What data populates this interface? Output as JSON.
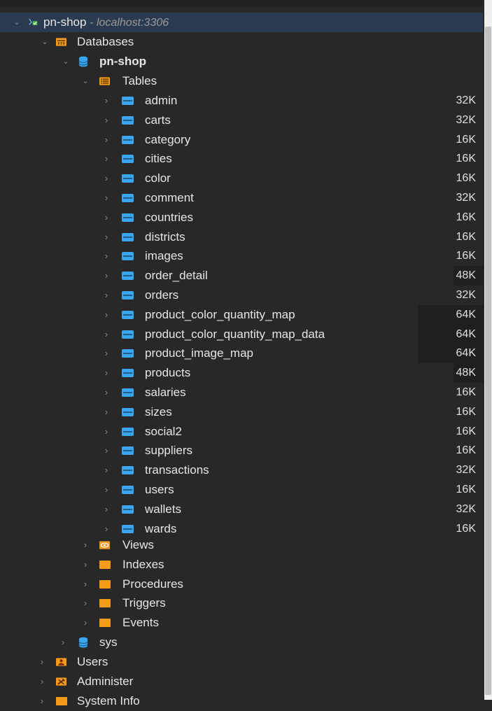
{
  "header_partial": "",
  "connection": {
    "name": "pn-shop",
    "host": "- localhost:3306"
  },
  "databases_label": "Databases",
  "database": {
    "name": "pn-shop"
  },
  "tables_label": "Tables",
  "tables": [
    {
      "name": "admin",
      "size": "32K"
    },
    {
      "name": "carts",
      "size": "32K"
    },
    {
      "name": "category",
      "size": "16K"
    },
    {
      "name": "cities",
      "size": "16K"
    },
    {
      "name": "color",
      "size": "16K"
    },
    {
      "name": "comment",
      "size": "32K"
    },
    {
      "name": "countries",
      "size": "16K"
    },
    {
      "name": "districts",
      "size": "16K"
    },
    {
      "name": "images",
      "size": "16K"
    },
    {
      "name": "order_detail",
      "size": "48K"
    },
    {
      "name": "orders",
      "size": "32K"
    },
    {
      "name": "product_color_quantity_map",
      "size": "64K"
    },
    {
      "name": "product_color_quantity_map_data",
      "size": "64K"
    },
    {
      "name": "product_image_map",
      "size": "64K"
    },
    {
      "name": "products",
      "size": "48K"
    },
    {
      "name": "salaries",
      "size": "16K"
    },
    {
      "name": "sizes",
      "size": "16K"
    },
    {
      "name": "social2",
      "size": "16K"
    },
    {
      "name": "suppliers",
      "size": "16K"
    },
    {
      "name": "transactions",
      "size": "32K"
    },
    {
      "name": "users",
      "size": "16K"
    },
    {
      "name": "wallets",
      "size": "32K"
    },
    {
      "name": "wards",
      "size": "16K"
    }
  ],
  "db_folders": [
    "Views",
    "Indexes",
    "Procedures",
    "Triggers",
    "Events"
  ],
  "other_db": "sys",
  "root_items": [
    "Users",
    "Administer",
    "System Info"
  ],
  "icons": {
    "table": "table-icon",
    "folder": "folder-icon",
    "database": "database-icon",
    "views": "eye-icon",
    "users": "users-icon",
    "administer": "tools-icon",
    "connection": "connection-icon"
  },
  "colors": {
    "accent_blue": "#39a7ef",
    "folder_orange": "#f59b1b",
    "background": "#282828",
    "selection": "#2a3b4f"
  }
}
